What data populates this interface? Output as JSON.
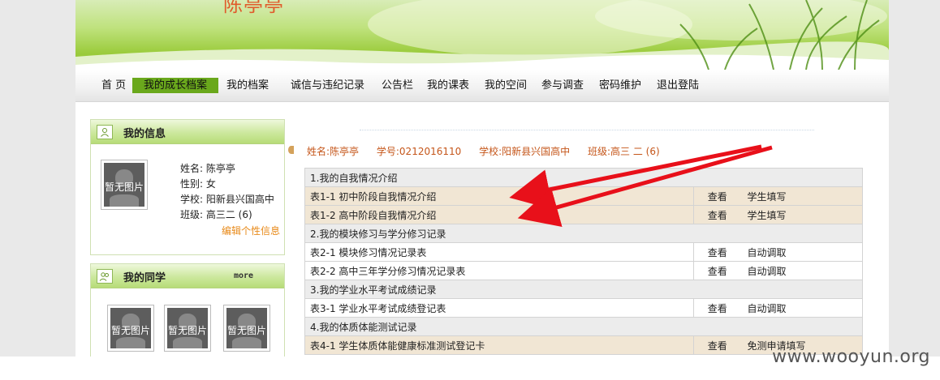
{
  "banner": {
    "title_fragment": "陈亭亭"
  },
  "nav": {
    "items": [
      {
        "label": "首 页"
      },
      {
        "label": "我的成长档案",
        "active": true
      },
      {
        "label": "我的档案"
      },
      {
        "label": "诚信与违纪记录"
      },
      {
        "label": "公告栏"
      },
      {
        "label": "我的课表"
      },
      {
        "label": "我的空间"
      },
      {
        "label": "参与调查"
      },
      {
        "label": "密码维护"
      },
      {
        "label": "退出登陆"
      }
    ]
  },
  "my_info": {
    "title": "我的信息",
    "photo_placeholder": "暂无图片",
    "name_line": "姓名: 陈亭亭",
    "gender_line": "性别: 女",
    "school_line": "学校: 阳新县兴国高中",
    "class_line": "班级: 高三二 (6)",
    "edit_link": "编辑个性信息"
  },
  "classmates": {
    "title": "我的同学",
    "more": "more",
    "photo_placeholders": [
      "暂无图片",
      "暂无图片",
      "暂无图片"
    ]
  },
  "student": {
    "name": "姓名:陈亭亭",
    "id": "学号:0212016110",
    "school": "学校:阳新县兴国高中",
    "class": "班级:高三 二 (6)"
  },
  "records": {
    "rows": [
      {
        "type": "section",
        "label": "1.我的自我情况介绍"
      },
      {
        "type": "item",
        "label": "表1-1 初中阶段自我情况介绍",
        "action": "查看",
        "source": "学生填写",
        "highlight": true
      },
      {
        "type": "item",
        "label": "表1-2 高中阶段自我情况介绍",
        "action": "查看",
        "source": "学生填写",
        "highlight": true
      },
      {
        "type": "section",
        "label": "2.我的模块修习与学分修习记录"
      },
      {
        "type": "item",
        "label": "表2-1 模块修习情况记录表",
        "action": "查看",
        "source": "自动调取",
        "highlight": false
      },
      {
        "type": "item",
        "label": "表2-2 高中三年学分修习情况记录表",
        "action": "查看",
        "source": "自动调取",
        "highlight": false
      },
      {
        "type": "section",
        "label": "3.我的学业水平考试成绩记录"
      },
      {
        "type": "item",
        "label": "表3-1 学业水平考试成绩登记表",
        "action": "查看",
        "source": "自动调取",
        "highlight": false
      },
      {
        "type": "section",
        "label": "4.我的体质体能测试记录"
      },
      {
        "type": "item",
        "label": "表4-1 学生体质体能健康标准测试登记卡",
        "action": "查看",
        "source": "免测申请填写",
        "highlight": true
      }
    ]
  },
  "watermark": "www.wooyun.org",
  "colors": {
    "nav_active": "#6aa81c",
    "student_bar": "#c5561a",
    "arrow": "#e8101a",
    "edit_link": "#e88a1a"
  }
}
